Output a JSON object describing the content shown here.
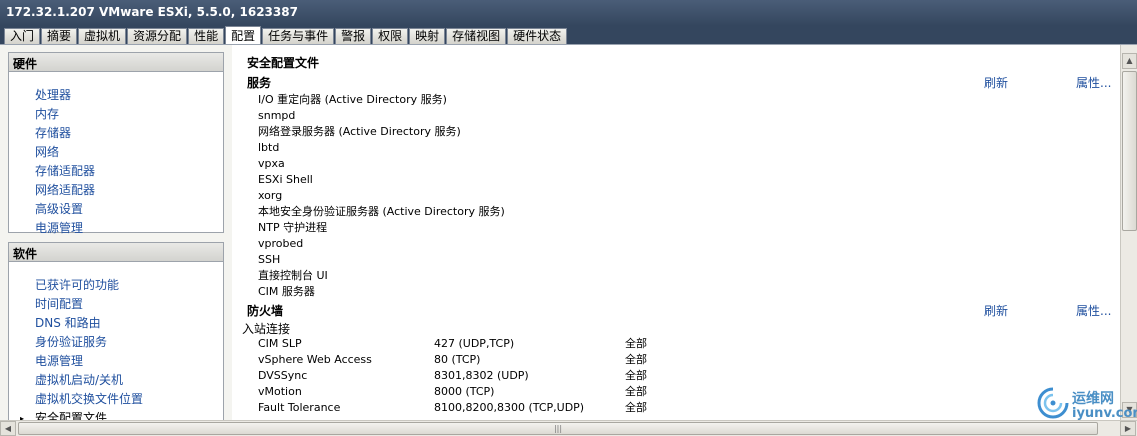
{
  "window": {
    "title": "172.32.1.207 VMware ESXi, 5.5.0, 1623387"
  },
  "tabs": [
    {
      "label": "入门"
    },
    {
      "label": "摘要"
    },
    {
      "label": "虚拟机"
    },
    {
      "label": "资源分配"
    },
    {
      "label": "性能"
    },
    {
      "label": "配置"
    },
    {
      "label": "任务与事件"
    },
    {
      "label": "警报"
    },
    {
      "label": "权限"
    },
    {
      "label": "映射"
    },
    {
      "label": "存储视图"
    },
    {
      "label": "硬件状态"
    }
  ],
  "active_tab": "配置",
  "hardware": {
    "header": "硬件",
    "items": [
      "处理器",
      "内存",
      "存储器",
      "网络",
      "存储适配器",
      "网络适配器",
      "高级设置",
      "电源管理"
    ]
  },
  "software": {
    "header": "软件",
    "items": [
      "已获许可的功能",
      "时间配置",
      "DNS 和路由",
      "身份验证服务",
      "电源管理",
      "虚拟机启动/关机",
      "虚拟机交换文件位置",
      "安全配置文件"
    ],
    "selected_index": 7
  },
  "main": {
    "title": "安全配置文件",
    "services": {
      "header": "服务",
      "refresh": "刷新",
      "properties": "属性...",
      "items": [
        "I/O 重定向器 (Active Directory 服务)",
        "snmpd",
        "网络登录服务器 (Active Directory 服务)",
        "lbtd",
        "vpxa",
        "ESXi Shell",
        "xorg",
        "本地安全身份验证服务器 (Active Directory 服务)",
        "NTP 守护进程",
        "vprobed",
        "SSH",
        "直接控制台 UI",
        "CIM 服务器"
      ]
    },
    "firewall": {
      "header": "防火墙",
      "refresh": "刷新",
      "properties": "属性...",
      "subheader": "入站连接",
      "rows": [
        {
          "name": "CIM SLP",
          "ports": "427 (UDP,TCP)",
          "scope": "全部"
        },
        {
          "name": "vSphere Web Access",
          "ports": "80 (TCP)",
          "scope": "全部"
        },
        {
          "name": "DVSSync",
          "ports": "8301,8302 (UDP)",
          "scope": "全部"
        },
        {
          "name": "vMotion",
          "ports": "8000 (TCP)",
          "scope": "全部"
        },
        {
          "name": "Fault Tolerance",
          "ports": "8100,8200,8300 (TCP,UDP)",
          "scope": "全部"
        }
      ]
    }
  },
  "watermark": {
    "line1": "运维网",
    "line2": "iyunv.com"
  }
}
